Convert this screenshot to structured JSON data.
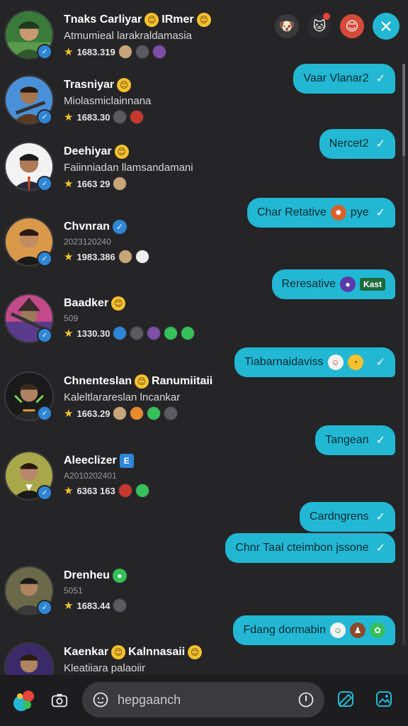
{
  "top_icons": [
    {
      "name": "sticker-icon",
      "glyph": "🐶"
    },
    {
      "name": "cat-icon",
      "glyph": "🐱"
    },
    {
      "name": "face-icon",
      "glyph": "😊"
    }
  ],
  "contacts": [
    {
      "name": "Tnaks Carliyar",
      "name_suffix": "IRmer",
      "sub": "Atmumieal larakraldamasia",
      "stat": "1683.319",
      "emoji": "😊"
    },
    {
      "name": "Trasniyar",
      "name_suffix": "",
      "sub": "Miolasmiclainnana",
      "stat": "1683.30",
      "emoji": "😊"
    },
    {
      "name": "Deehiyar",
      "name_suffix": "",
      "sub": "Faiinniadan llamsandamani",
      "stat": "1663 29",
      "emoji": "😊"
    },
    {
      "name": "Chvnran",
      "name_suffix": "",
      "sub": "2023120240",
      "stat": "1983.386",
      "emoji": "✓"
    },
    {
      "name": "Baadker",
      "name_suffix": "",
      "sub": "509",
      "stat": "1330.30",
      "emoji": "😊"
    },
    {
      "name": "Chnenteslan",
      "name_suffix": "Ranumiitaii",
      "sub": "Kaleltlarareslan lncankar",
      "stat": "1663.29",
      "emoji": "😊"
    },
    {
      "name": "Aleeclizer",
      "name_suffix": "",
      "sub": "A2010202401",
      "stat": "6363 163",
      "emoji": "E"
    },
    {
      "name": "Drenheu",
      "name_suffix": "",
      "sub": "5051",
      "stat": "1683.44",
      "emoji": "●"
    },
    {
      "name": "Kaenkar",
      "name_suffix": "Kalnnasaii",
      "sub": "Kleatiiara palaoiir",
      "stat": "",
      "emoji": "😊"
    }
  ],
  "messages": [
    {
      "text": "Vaar Vlanar2"
    },
    {
      "text": "Nercet2"
    },
    {
      "text": "Char Retative",
      "extra": "pye"
    },
    {
      "text": "Reresative",
      "tag": "Kast"
    },
    {
      "text": "Tiabarnaidaviss"
    },
    {
      "text": "Tangean"
    },
    {
      "text": "Cardngrens"
    },
    {
      "text": "Chnr Taal cteimbon jssone"
    },
    {
      "text": "Fdang dormabin"
    }
  ],
  "search": {
    "placeholder": "hepgaanch",
    "value": ""
  },
  "colors": {
    "accent": "#22b8d4",
    "background": "#252527",
    "bottom_bar": "#1d1d20",
    "verified": "#2f86d6",
    "star": "#f4c430"
  }
}
